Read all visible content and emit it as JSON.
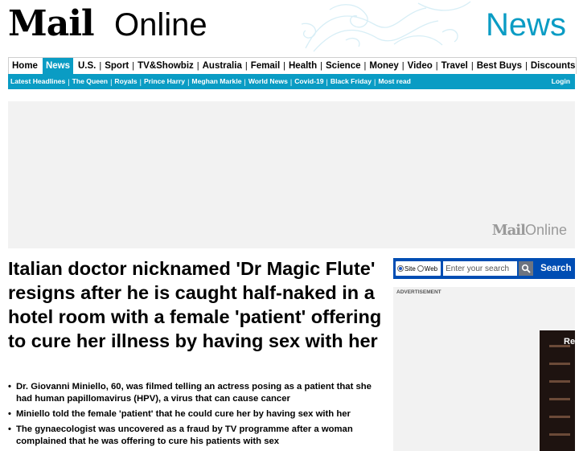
{
  "masthead": {
    "logo_mail": "Mail",
    "logo_online": "Online",
    "section": "News"
  },
  "nav_primary": [
    {
      "label": "Home",
      "active": false
    },
    {
      "label": "News",
      "active": true
    },
    {
      "label": "U.S.",
      "active": false
    },
    {
      "label": "Sport",
      "active": false
    },
    {
      "label": "TV&Showbiz",
      "active": false
    },
    {
      "label": "Australia",
      "active": false
    },
    {
      "label": "Femail",
      "active": false
    },
    {
      "label": "Health",
      "active": false
    },
    {
      "label": "Science",
      "active": false
    },
    {
      "label": "Money",
      "active": false
    },
    {
      "label": "Video",
      "active": false
    },
    {
      "label": "Travel",
      "active": false
    },
    {
      "label": "Best Buys",
      "active": false
    },
    {
      "label": "Discounts",
      "active": false
    }
  ],
  "nav_secondary": [
    "Latest Headlines",
    "The Queen",
    "Royals",
    "Prince Harry",
    "Meghan Markle",
    "World News",
    "Covid-19",
    "Black Friday",
    "Most read"
  ],
  "login_label": "Login",
  "ad_banner": {
    "logo_mail": "Mail",
    "logo_online": "Online"
  },
  "article": {
    "headline": "Italian doctor nicknamed 'Dr Magic Flute' resigns after he is caught half-naked in a hotel room with a female 'patient' offering to cure her illness by having sex with her",
    "bullets": [
      "Dr. Giovanni Miniello, 60, was filmed telling an actress posing as a patient that she had human papillomavirus (HPV), a virus that can cause cancer",
      "Miniello told the female 'patient' that he could cure her by having sex with her",
      "The gynaecologist was uncovered as a fraud by TV programme after a woman complained that he was offering to cure his patients with sex"
    ]
  },
  "search": {
    "option_site": "Site",
    "option_web": "Web",
    "selected": "Site",
    "placeholder": "Enter your search",
    "button_label": "Search"
  },
  "ad_right": {
    "label": "ADVERTISEMENT",
    "partial_text": "Rea"
  },
  "colors": {
    "brand_blue": "#0a9cc4",
    "search_blue": "#004db3",
    "ad_gray": "#f2f2f2"
  },
  "icons": [
    "search-icon"
  ]
}
